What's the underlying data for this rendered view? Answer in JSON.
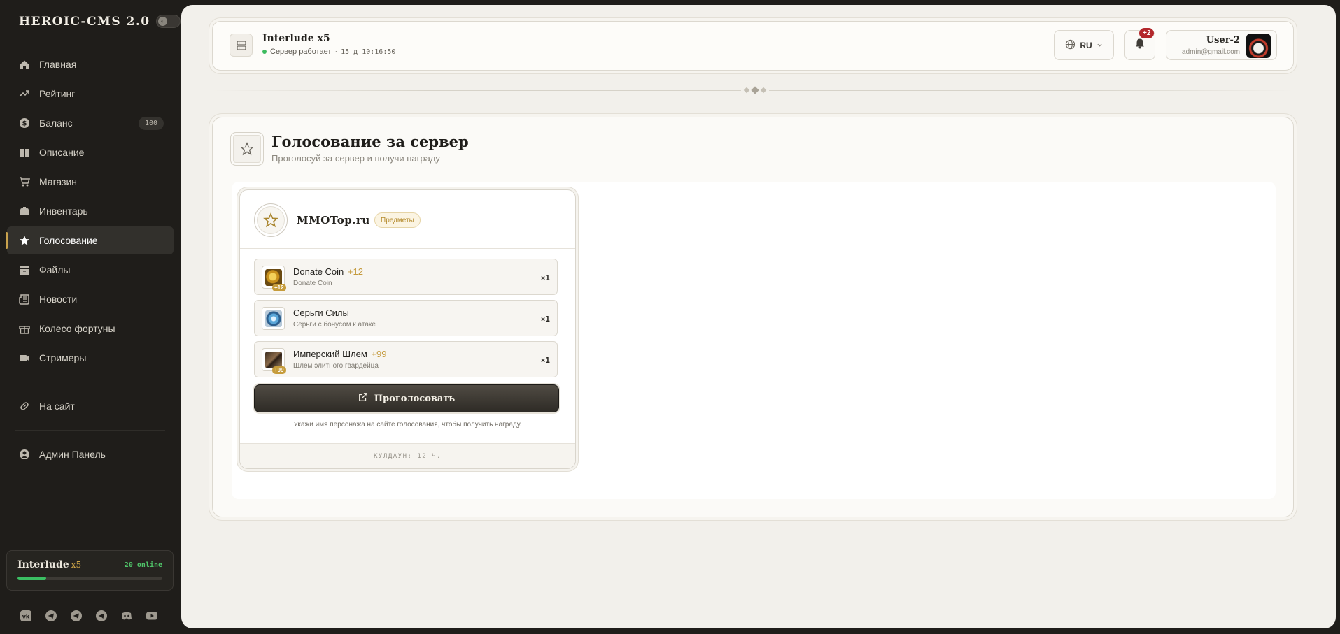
{
  "brand": {
    "title": "HEROIC-CMS 2.0"
  },
  "sidebar": {
    "items": [
      {
        "label": "Главная",
        "icon": "home-icon"
      },
      {
        "label": "Рейтинг",
        "icon": "trending-icon"
      },
      {
        "label": "Баланс",
        "icon": "dollar-icon",
        "badge": "100"
      },
      {
        "label": "Описание",
        "icon": "book-icon"
      },
      {
        "label": "Магазин",
        "icon": "cart-icon"
      },
      {
        "label": "Инвентарь",
        "icon": "backpack-icon"
      },
      {
        "label": "Голосование",
        "icon": "star-icon",
        "active": true
      },
      {
        "label": "Файлы",
        "icon": "archive-icon"
      },
      {
        "label": "Новости",
        "icon": "newspaper-icon"
      },
      {
        "label": "Колесо фортуны",
        "icon": "gift-icon"
      },
      {
        "label": "Стримеры",
        "icon": "video-icon"
      }
    ],
    "external": {
      "label": "На сайт",
      "icon": "link-icon"
    },
    "admin": {
      "label": "Админ Панель",
      "icon": "user-circle-icon"
    },
    "server": {
      "name": "Interlude",
      "rate": "x5",
      "online": "20 online",
      "load_fraction": 0.2
    },
    "social": [
      "vk-icon",
      "telegram-icon",
      "telegram-icon",
      "telegram-icon",
      "discord-icon",
      "youtube-icon"
    ]
  },
  "topbar": {
    "server_title": "Interlude x5",
    "status": "Сервер работает",
    "separator": "·",
    "uptime": "15 д 10:16:50",
    "language": "RU",
    "notifications": "+2",
    "user_name": "User-2",
    "user_email": "admin@gmail.com"
  },
  "page": {
    "title": "Голосование за сервер",
    "subtitle": "Проголосуй за сервер и получи награду"
  },
  "vote": {
    "site": "MMOTop.ru",
    "tag": "Предметы",
    "rewards": [
      {
        "name": "Donate Coin",
        "plus": "+12",
        "desc": "Donate Coin",
        "qty": "×1",
        "badge": "+12"
      },
      {
        "name": "Серьги Силы",
        "plus": "",
        "desc": "Серьги с бонусом к атаке",
        "qty": "×1",
        "badge": ""
      },
      {
        "name": "Имперский Шлем",
        "plus": "+99",
        "desc": "Шлем элитного гвардейца",
        "qty": "×1",
        "badge": "+99"
      }
    ],
    "button": "Проголосовать",
    "hint": "Укажи имя персонажа на сайте голосования, чтобы получить награду.",
    "cooldown": "КУЛДАУН: 12 Ч."
  },
  "colors": {
    "accent": "#c9a24d",
    "online": "#3bbf63",
    "badge_red": "#b3282c",
    "dark": "#1f1d1a"
  }
}
